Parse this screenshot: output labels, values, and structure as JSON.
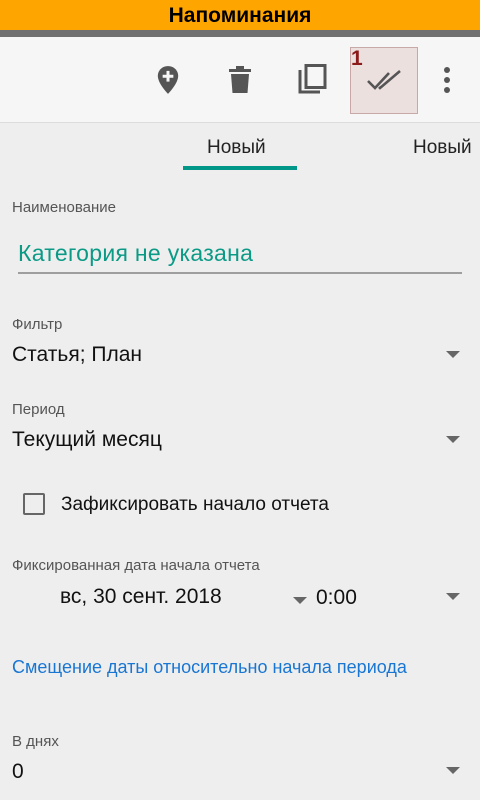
{
  "app": {
    "title": "Напоминания"
  },
  "toolbar": {
    "icons": [
      "add-location-icon",
      "delete-icon",
      "copy-icon",
      "done-all-icon",
      "more-vert-icon"
    ],
    "badge": "1"
  },
  "tabs": [
    {
      "label": "Новый",
      "active": true
    },
    {
      "label": "Новый",
      "active": false
    }
  ],
  "form": {
    "name": {
      "label": "Наименование",
      "value": "Категория не указана"
    },
    "filter": {
      "label": "Фильтр",
      "value": "Статья; План"
    },
    "period": {
      "label": "Период",
      "value": "Текущий месяц"
    },
    "fix_start": {
      "label": "Зафиксировать начало отчета",
      "checked": false
    },
    "fixed_date": {
      "label": "Фиксированная дата начала отчета",
      "date": "вс, 30 сент. 2018",
      "time": "0:00"
    },
    "offset_link": "Смещение даты относительно начала периода",
    "days": {
      "label": "В днях",
      "value": "0"
    }
  },
  "colors": {
    "title_bar": "#ffa500",
    "accent": "#009688",
    "link": "#1976d2"
  }
}
